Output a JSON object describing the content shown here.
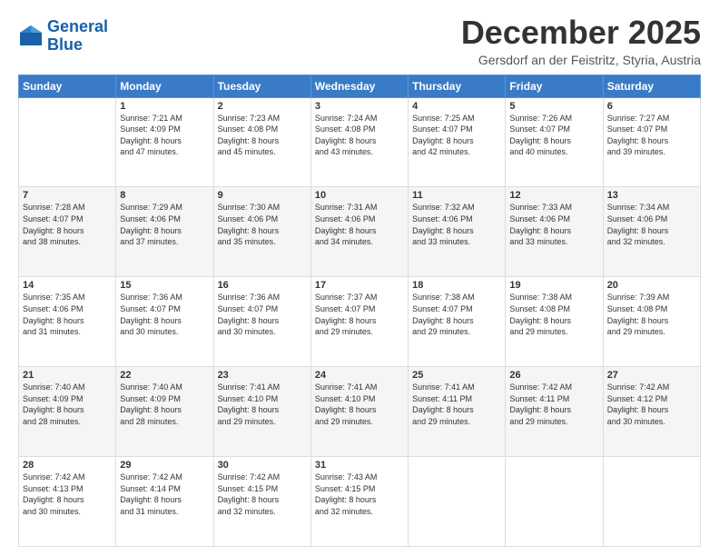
{
  "logo": {
    "line1": "General",
    "line2": "Blue"
  },
  "header": {
    "title": "December 2025",
    "location": "Gersdorf an der Feistritz, Styria, Austria"
  },
  "weekdays": [
    "Sunday",
    "Monday",
    "Tuesday",
    "Wednesday",
    "Thursday",
    "Friday",
    "Saturday"
  ],
  "weeks": [
    [
      {
        "day": "",
        "info": ""
      },
      {
        "day": "1",
        "info": "Sunrise: 7:21 AM\nSunset: 4:09 PM\nDaylight: 8 hours\nand 47 minutes."
      },
      {
        "day": "2",
        "info": "Sunrise: 7:23 AM\nSunset: 4:08 PM\nDaylight: 8 hours\nand 45 minutes."
      },
      {
        "day": "3",
        "info": "Sunrise: 7:24 AM\nSunset: 4:08 PM\nDaylight: 8 hours\nand 43 minutes."
      },
      {
        "day": "4",
        "info": "Sunrise: 7:25 AM\nSunset: 4:07 PM\nDaylight: 8 hours\nand 42 minutes."
      },
      {
        "day": "5",
        "info": "Sunrise: 7:26 AM\nSunset: 4:07 PM\nDaylight: 8 hours\nand 40 minutes."
      },
      {
        "day": "6",
        "info": "Sunrise: 7:27 AM\nSunset: 4:07 PM\nDaylight: 8 hours\nand 39 minutes."
      }
    ],
    [
      {
        "day": "7",
        "info": "Sunrise: 7:28 AM\nSunset: 4:07 PM\nDaylight: 8 hours\nand 38 minutes."
      },
      {
        "day": "8",
        "info": "Sunrise: 7:29 AM\nSunset: 4:06 PM\nDaylight: 8 hours\nand 37 minutes."
      },
      {
        "day": "9",
        "info": "Sunrise: 7:30 AM\nSunset: 4:06 PM\nDaylight: 8 hours\nand 35 minutes."
      },
      {
        "day": "10",
        "info": "Sunrise: 7:31 AM\nSunset: 4:06 PM\nDaylight: 8 hours\nand 34 minutes."
      },
      {
        "day": "11",
        "info": "Sunrise: 7:32 AM\nSunset: 4:06 PM\nDaylight: 8 hours\nand 33 minutes."
      },
      {
        "day": "12",
        "info": "Sunrise: 7:33 AM\nSunset: 4:06 PM\nDaylight: 8 hours\nand 33 minutes."
      },
      {
        "day": "13",
        "info": "Sunrise: 7:34 AM\nSunset: 4:06 PM\nDaylight: 8 hours\nand 32 minutes."
      }
    ],
    [
      {
        "day": "14",
        "info": "Sunrise: 7:35 AM\nSunset: 4:06 PM\nDaylight: 8 hours\nand 31 minutes."
      },
      {
        "day": "15",
        "info": "Sunrise: 7:36 AM\nSunset: 4:07 PM\nDaylight: 8 hours\nand 30 minutes."
      },
      {
        "day": "16",
        "info": "Sunrise: 7:36 AM\nSunset: 4:07 PM\nDaylight: 8 hours\nand 30 minutes."
      },
      {
        "day": "17",
        "info": "Sunrise: 7:37 AM\nSunset: 4:07 PM\nDaylight: 8 hours\nand 29 minutes."
      },
      {
        "day": "18",
        "info": "Sunrise: 7:38 AM\nSunset: 4:07 PM\nDaylight: 8 hours\nand 29 minutes."
      },
      {
        "day": "19",
        "info": "Sunrise: 7:38 AM\nSunset: 4:08 PM\nDaylight: 8 hours\nand 29 minutes."
      },
      {
        "day": "20",
        "info": "Sunrise: 7:39 AM\nSunset: 4:08 PM\nDaylight: 8 hours\nand 29 minutes."
      }
    ],
    [
      {
        "day": "21",
        "info": "Sunrise: 7:40 AM\nSunset: 4:09 PM\nDaylight: 8 hours\nand 28 minutes."
      },
      {
        "day": "22",
        "info": "Sunrise: 7:40 AM\nSunset: 4:09 PM\nDaylight: 8 hours\nand 28 minutes."
      },
      {
        "day": "23",
        "info": "Sunrise: 7:41 AM\nSunset: 4:10 PM\nDaylight: 8 hours\nand 29 minutes."
      },
      {
        "day": "24",
        "info": "Sunrise: 7:41 AM\nSunset: 4:10 PM\nDaylight: 8 hours\nand 29 minutes."
      },
      {
        "day": "25",
        "info": "Sunrise: 7:41 AM\nSunset: 4:11 PM\nDaylight: 8 hours\nand 29 minutes."
      },
      {
        "day": "26",
        "info": "Sunrise: 7:42 AM\nSunset: 4:11 PM\nDaylight: 8 hours\nand 29 minutes."
      },
      {
        "day": "27",
        "info": "Sunrise: 7:42 AM\nSunset: 4:12 PM\nDaylight: 8 hours\nand 30 minutes."
      }
    ],
    [
      {
        "day": "28",
        "info": "Sunrise: 7:42 AM\nSunset: 4:13 PM\nDaylight: 8 hours\nand 30 minutes."
      },
      {
        "day": "29",
        "info": "Sunrise: 7:42 AM\nSunset: 4:14 PM\nDaylight: 8 hours\nand 31 minutes."
      },
      {
        "day": "30",
        "info": "Sunrise: 7:42 AM\nSunset: 4:15 PM\nDaylight: 8 hours\nand 32 minutes."
      },
      {
        "day": "31",
        "info": "Sunrise: 7:43 AM\nSunset: 4:15 PM\nDaylight: 8 hours\nand 32 minutes."
      },
      {
        "day": "",
        "info": ""
      },
      {
        "day": "",
        "info": ""
      },
      {
        "day": "",
        "info": ""
      }
    ]
  ]
}
